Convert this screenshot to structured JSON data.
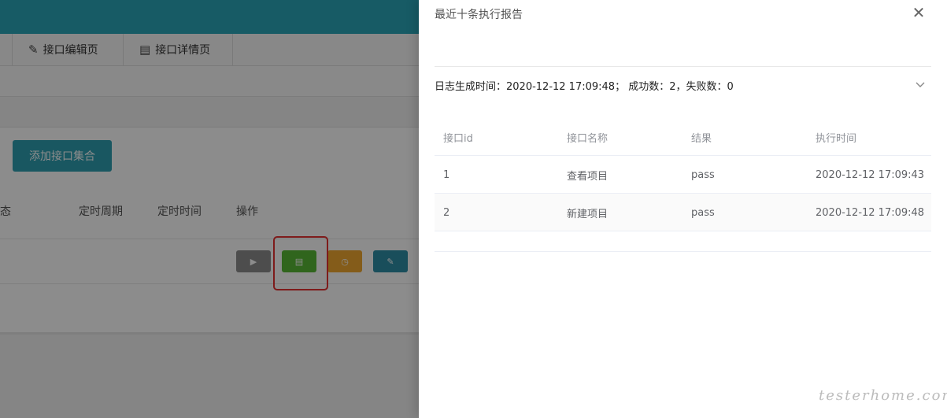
{
  "background": {
    "tabs": [
      {
        "icon": "edit-icon",
        "label": "接口编辑页"
      },
      {
        "icon": "document-icon",
        "label": "接口详情页"
      }
    ],
    "add_button": "添加接口集合",
    "table_headers": [
      "态",
      "定时周期",
      "定时时间",
      "操作"
    ],
    "op_buttons": [
      "run-icon",
      "log-icon",
      "clock-icon",
      "edit-icon"
    ],
    "colors": {
      "topbar": "#2aa7b8",
      "run": "#8c8c8c",
      "log": "#58b836",
      "timer": "#f0a830",
      "edit": "#2e8ea6",
      "highlight": "#e63232"
    }
  },
  "drawer": {
    "title": "最近十条执行报告",
    "collapse_header": "日志生成时间：2020-12-12 17:09:48； 成功数：2，失败数：0",
    "columns": [
      "接口id",
      "接口名称",
      "结果",
      "执行时间"
    ],
    "rows": [
      [
        "1",
        "查看项目",
        "pass",
        "2020-12-12 17:09:43"
      ],
      [
        "2",
        "新建项目",
        "pass",
        "2020-12-12 17:09:48"
      ]
    ]
  },
  "watermark": "testerhome.com"
}
